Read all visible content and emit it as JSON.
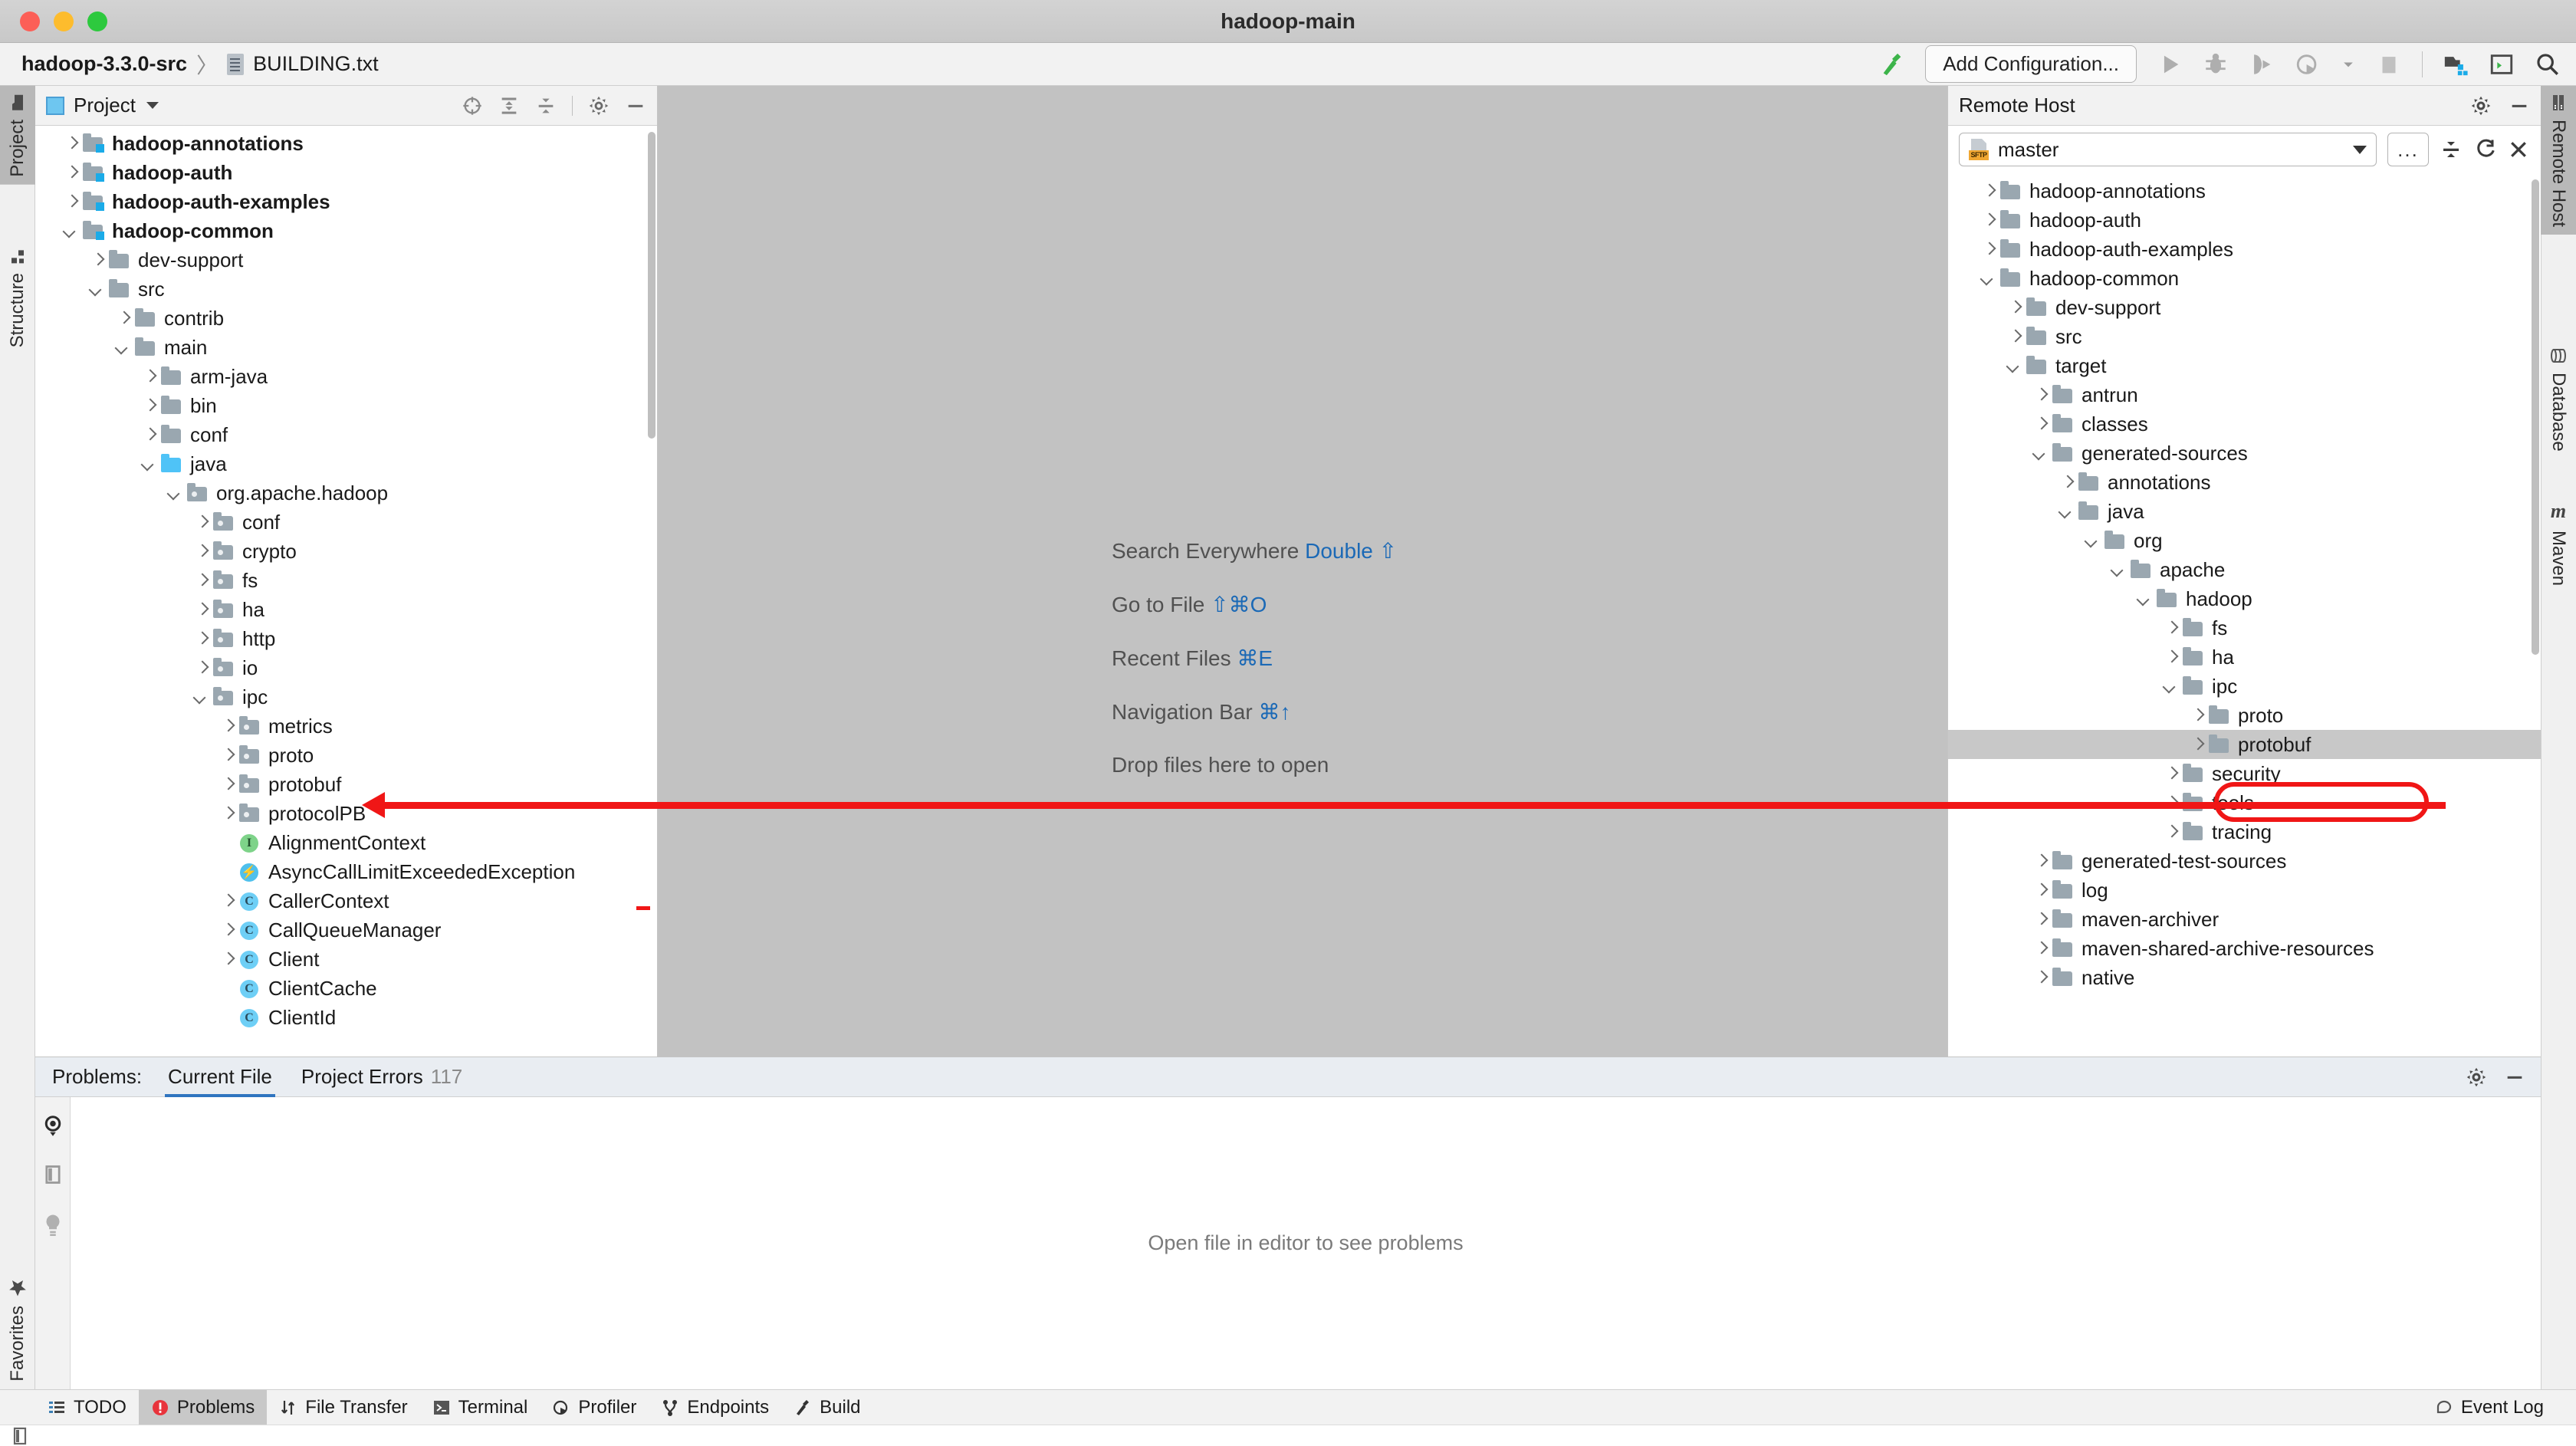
{
  "window": {
    "title": "hadoop-main"
  },
  "breadcrumb": {
    "project": "hadoop-3.3.0-src",
    "separator": "〉",
    "file": "BUILDING.txt",
    "file_icon": "text-file-icon"
  },
  "toolbar": {
    "build_icon": "hammer-icon",
    "add_configuration": "Add Configuration...",
    "run_icon": "run-icon",
    "debug_icon": "debug-icon",
    "run_coverage_icon": "run-with-coverage-icon",
    "profile_icon": "profile-icon",
    "profile_dropdown_icon": "chevron-down-icon",
    "stop_icon": "stop-icon",
    "project_structure_icon": "project-structure-icon",
    "terminal_icon": "terminal-icon",
    "search_icon": "search-icon"
  },
  "left_stripe": {
    "tabs": [
      {
        "label": "Project",
        "icon": "folder-icon",
        "active": true
      },
      {
        "label": "Structure",
        "icon": "structure-icon",
        "active": false
      }
    ],
    "bottom_tabs": [
      {
        "label": "Favorites",
        "icon": "star-icon",
        "active": false
      }
    ]
  },
  "right_stripe": {
    "tabs": [
      {
        "label": "Remote Host",
        "icon": "server-icon",
        "active": true
      },
      {
        "label": "Database",
        "icon": "database-icon",
        "active": false
      },
      {
        "label": "Maven",
        "icon": "maven-icon",
        "active": false
      }
    ]
  },
  "project_panel": {
    "title": "Project",
    "dropdown_icon": "chevron-down-icon",
    "icons": [
      "scroll-from-source-icon",
      "expand-all-icon",
      "collapse-all-icon",
      "gear-icon",
      "hide-icon"
    ],
    "tree": [
      {
        "label": "hadoop-annotations",
        "depth": 0,
        "state": "closed",
        "icon": "module-folder-icon",
        "bold": true
      },
      {
        "label": "hadoop-auth",
        "depth": 0,
        "state": "closed",
        "icon": "module-folder-icon",
        "bold": true
      },
      {
        "label": "hadoop-auth-examples",
        "depth": 0,
        "state": "closed",
        "icon": "module-folder-icon",
        "bold": true
      },
      {
        "label": "hadoop-common",
        "depth": 0,
        "state": "open",
        "icon": "module-folder-icon",
        "bold": true
      },
      {
        "label": "dev-support",
        "depth": 1,
        "state": "closed",
        "icon": "folder-icon",
        "bold": false
      },
      {
        "label": "src",
        "depth": 1,
        "state": "open",
        "icon": "folder-icon",
        "bold": false
      },
      {
        "label": "contrib",
        "depth": 2,
        "state": "closed",
        "icon": "folder-icon",
        "bold": false
      },
      {
        "label": "main",
        "depth": 2,
        "state": "open",
        "icon": "folder-icon",
        "bold": false
      },
      {
        "label": "arm-java",
        "depth": 3,
        "state": "closed",
        "icon": "folder-icon",
        "bold": false
      },
      {
        "label": "bin",
        "depth": 3,
        "state": "closed",
        "icon": "folder-icon",
        "bold": false
      },
      {
        "label": "conf",
        "depth": 3,
        "state": "closed",
        "icon": "folder-icon",
        "bold": false
      },
      {
        "label": "java",
        "depth": 3,
        "state": "open",
        "icon": "source-folder-icon",
        "bold": false
      },
      {
        "label": "org.apache.hadoop",
        "depth": 4,
        "state": "open",
        "icon": "package-icon",
        "bold": false
      },
      {
        "label": "conf",
        "depth": 5,
        "state": "closed",
        "icon": "package-icon",
        "bold": false
      },
      {
        "label": "crypto",
        "depth": 5,
        "state": "closed",
        "icon": "package-icon",
        "bold": false
      },
      {
        "label": "fs",
        "depth": 5,
        "state": "closed",
        "icon": "package-icon",
        "bold": false
      },
      {
        "label": "ha",
        "depth": 5,
        "state": "closed",
        "icon": "package-icon",
        "bold": false
      },
      {
        "label": "http",
        "depth": 5,
        "state": "closed",
        "icon": "package-icon",
        "bold": false
      },
      {
        "label": "io",
        "depth": 5,
        "state": "closed",
        "icon": "package-icon",
        "bold": false
      },
      {
        "label": "ipc",
        "depth": 5,
        "state": "open",
        "icon": "package-icon",
        "bold": false
      },
      {
        "label": "metrics",
        "depth": 6,
        "state": "closed",
        "icon": "package-icon",
        "bold": false
      },
      {
        "label": "proto",
        "depth": 6,
        "state": "closed",
        "icon": "package-icon",
        "bold": false
      },
      {
        "label": "protobuf",
        "depth": 6,
        "state": "closed",
        "icon": "package-icon",
        "bold": false
      },
      {
        "label": "protocolPB",
        "depth": 6,
        "state": "closed",
        "icon": "package-icon",
        "bold": false
      },
      {
        "label": "AlignmentContext",
        "depth": 6,
        "state": "leaf",
        "icon": "interface-icon",
        "bold": false
      },
      {
        "label": "AsyncCallLimitExceededException",
        "depth": 6,
        "state": "leaf",
        "icon": "exception-class-icon",
        "bold": false
      },
      {
        "label": "CallerContext",
        "depth": 6,
        "state": "closed",
        "icon": "class-icon",
        "bold": false
      },
      {
        "label": "CallQueueManager",
        "depth": 6,
        "state": "closed",
        "icon": "class-icon",
        "bold": false
      },
      {
        "label": "Client",
        "depth": 6,
        "state": "closed",
        "icon": "class-icon",
        "bold": false
      },
      {
        "label": "ClientCache",
        "depth": 6,
        "state": "leaf",
        "icon": "class-icon",
        "bold": false
      },
      {
        "label": "ClientId",
        "depth": 6,
        "state": "leaf",
        "icon": "class-icon",
        "bold": false
      }
    ]
  },
  "editor": {
    "shortcuts": [
      {
        "action": "Search Everywhere",
        "keys": "Double ⇧"
      },
      {
        "action": "Go to File",
        "keys": "⇧⌘O"
      },
      {
        "action": "Recent Files",
        "keys": "⌘E"
      },
      {
        "action": "Navigation Bar",
        "keys": "⌘↑"
      }
    ],
    "drop_hint": "Drop files here to open"
  },
  "remote_panel": {
    "title": "Remote Host",
    "icons": [
      "gear-icon",
      "hide-icon"
    ],
    "host": {
      "name": "master",
      "protocol_badge": "SFTP",
      "icon": "sftp-file-icon",
      "dropdown_icon": "chevron-down-icon"
    },
    "ellipsis_label": "...",
    "toolbar_icons": [
      "collapse-all-icon",
      "refresh-icon",
      "close-icon"
    ],
    "tree": [
      {
        "label": "hadoop-annotations",
        "depth": 0,
        "state": "closed",
        "icon": "folder-icon",
        "selected": false
      },
      {
        "label": "hadoop-auth",
        "depth": 0,
        "state": "closed",
        "icon": "folder-icon",
        "selected": false
      },
      {
        "label": "hadoop-auth-examples",
        "depth": 0,
        "state": "closed",
        "icon": "folder-icon",
        "selected": false
      },
      {
        "label": "hadoop-common",
        "depth": 0,
        "state": "open",
        "icon": "folder-icon",
        "selected": false
      },
      {
        "label": "dev-support",
        "depth": 1,
        "state": "closed",
        "icon": "folder-icon",
        "selected": false
      },
      {
        "label": "src",
        "depth": 1,
        "state": "closed",
        "icon": "folder-icon",
        "selected": false
      },
      {
        "label": "target",
        "depth": 1,
        "state": "open",
        "icon": "folder-icon",
        "selected": false
      },
      {
        "label": "antrun",
        "depth": 2,
        "state": "closed",
        "icon": "folder-icon",
        "selected": false
      },
      {
        "label": "classes",
        "depth": 2,
        "state": "closed",
        "icon": "folder-icon",
        "selected": false
      },
      {
        "label": "generated-sources",
        "depth": 2,
        "state": "open",
        "icon": "folder-icon",
        "selected": false
      },
      {
        "label": "annotations",
        "depth": 3,
        "state": "closed",
        "icon": "folder-icon",
        "selected": false
      },
      {
        "label": "java",
        "depth": 3,
        "state": "open",
        "icon": "folder-icon",
        "selected": false
      },
      {
        "label": "org",
        "depth": 4,
        "state": "open",
        "icon": "folder-icon",
        "selected": false
      },
      {
        "label": "apache",
        "depth": 5,
        "state": "open",
        "icon": "folder-icon",
        "selected": false
      },
      {
        "label": "hadoop",
        "depth": 6,
        "state": "open",
        "icon": "folder-icon",
        "selected": false
      },
      {
        "label": "fs",
        "depth": 7,
        "state": "closed",
        "icon": "folder-icon",
        "selected": false
      },
      {
        "label": "ha",
        "depth": 7,
        "state": "closed",
        "icon": "folder-icon",
        "selected": false
      },
      {
        "label": "ipc",
        "depth": 7,
        "state": "open",
        "icon": "folder-icon",
        "selected": false
      },
      {
        "label": "proto",
        "depth": 8,
        "state": "closed",
        "icon": "folder-icon",
        "selected": false
      },
      {
        "label": "protobuf",
        "depth": 8,
        "state": "closed",
        "icon": "folder-icon",
        "selected": true
      },
      {
        "label": "security",
        "depth": 7,
        "state": "closed",
        "icon": "folder-icon",
        "selected": false
      },
      {
        "label": "tools",
        "depth": 7,
        "state": "closed",
        "icon": "folder-icon",
        "selected": false
      },
      {
        "label": "tracing",
        "depth": 7,
        "state": "closed",
        "icon": "folder-icon",
        "selected": false
      },
      {
        "label": "generated-test-sources",
        "depth": 2,
        "state": "closed",
        "icon": "folder-icon",
        "selected": false
      },
      {
        "label": "log",
        "depth": 2,
        "state": "closed",
        "icon": "folder-icon",
        "selected": false
      },
      {
        "label": "maven-archiver",
        "depth": 2,
        "state": "closed",
        "icon": "folder-icon",
        "selected": false
      },
      {
        "label": "maven-shared-archive-resources",
        "depth": 2,
        "state": "closed",
        "icon": "folder-icon",
        "selected": false
      },
      {
        "label": "native",
        "depth": 2,
        "state": "closed",
        "icon": "folder-icon",
        "selected": false
      }
    ]
  },
  "problems_panel": {
    "label": "Problems:",
    "tabs": [
      {
        "label": "Current File",
        "count": "",
        "active": true
      },
      {
        "label": "Project Errors",
        "count": "117",
        "active": false
      }
    ],
    "side_icons": [
      "eye-icon",
      "preview-icon",
      "lightbulb-icon"
    ],
    "header_icons": [
      "gear-icon",
      "hide-icon"
    ],
    "empty_message": "Open file in editor to see problems"
  },
  "statusbar": {
    "items": [
      {
        "label": "TODO",
        "icon": "todo-list-icon",
        "active": false
      },
      {
        "label": "Problems",
        "icon": "error-circle-icon",
        "active": true
      },
      {
        "label": "File Transfer",
        "icon": "transfer-arrows-icon",
        "active": false
      },
      {
        "label": "Terminal",
        "icon": "terminal-icon",
        "active": false
      },
      {
        "label": "Profiler",
        "icon": "profiler-icon",
        "active": false
      },
      {
        "label": "Endpoints",
        "icon": "endpoints-icon",
        "active": false
      },
      {
        "label": "Build",
        "icon": "hammer-icon",
        "active": false
      }
    ],
    "event_log": {
      "label": "Event Log",
      "icon": "balloon-icon"
    }
  },
  "colors": {
    "accent_blue": "#2f74c0",
    "link_blue": "#1b69b6",
    "annotation_red": "#f01616",
    "source_folder": "#4fc3f7",
    "selection_gray": "#c8c8c8",
    "error_red": "#e8343c"
  }
}
